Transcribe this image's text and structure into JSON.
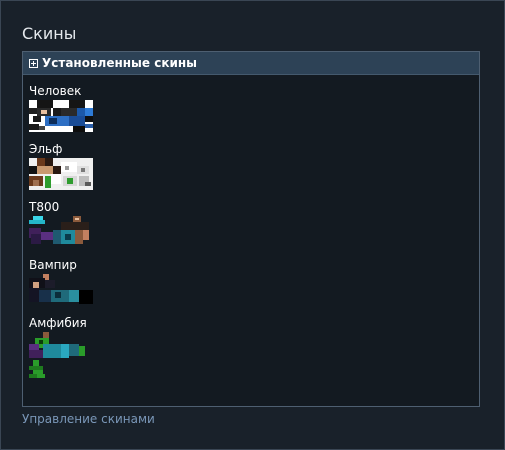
{
  "window_title": "Скины",
  "panel": {
    "header": "Установленные скины",
    "toggle_icon": "plus-box-icon"
  },
  "skins": [
    {
      "name": "Человек"
    },
    {
      "name": "Эльф"
    },
    {
      "name": "T800"
    },
    {
      "name": "Вампир"
    },
    {
      "name": "Амфибия"
    }
  ],
  "manage_link": "Управление скинами"
}
